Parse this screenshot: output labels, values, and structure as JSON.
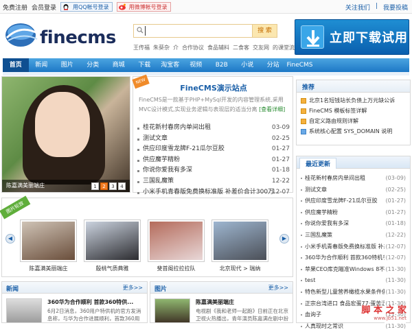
{
  "topbar": {
    "register": "免费注册",
    "login": "会员登录",
    "qq_login": "用QQ帐号登录",
    "weibo_login": "用微博帐号登录",
    "follow": "关注我们",
    "submit": "我要投稿"
  },
  "header": {
    "logo_text": "finecms",
    "search_placeholder": "",
    "search_button": "搜 索",
    "hotwords": [
      "王传福",
      "朱葵杂",
      "介",
      "合作协议",
      "食品辅料",
      "二食客",
      "交友网",
      "的课堂流程"
    ],
    "download_banner": "立即下载试用"
  },
  "nav": {
    "items": [
      "首页",
      "新闻",
      "图片",
      "分类",
      "商城",
      "下载",
      "淘宝客",
      "视频",
      "B2B",
      "小说",
      "分站",
      "FineCMS"
    ],
    "active_index": 0
  },
  "focus": {
    "caption": "陈嘉满美丽端庄",
    "pages": [
      "1",
      "2",
      "3",
      "4"
    ],
    "active_page": 1
  },
  "center": {
    "new_tag": "NEW",
    "title": "FineCMS演示站点",
    "intro": "FineCMS是一款基于PHP+MySql开发的内容管理系统,采用MVC设计模式,实现业务逻辑与表现层的适当分离",
    "intro_more": "[查看详细]",
    "items": [
      {
        "title": "桂花新村春房内单间出租",
        "date": "03-09"
      },
      {
        "title": "测试文章",
        "date": "02-25"
      },
      {
        "title": "供应印度雪龙牌F-21瓜尔豆胶",
        "date": "01-27"
      },
      {
        "title": "供应魔芋精粉",
        "date": "01-27"
      },
      {
        "title": "你说你爱我有多深",
        "date": "01-18"
      },
      {
        "title": "三国乱魔策",
        "date": "12-22"
      },
      {
        "title": "小米手机青春版免费换标准版 补差价合计300万",
        "date": "12-07"
      }
    ]
  },
  "recommend": {
    "title": "推荐",
    "items": [
      "北京1名短钱站长负债上万元缺公诉",
      "FineCMS 模板标签详解",
      "自定义路由规则详解",
      "系统核心配置 SYS_DOMAIN 说明"
    ]
  },
  "latest": {
    "title": "最近更新",
    "items": [
      {
        "title": "桂花新村春房内单间出租",
        "date": "(03-09)"
      },
      {
        "title": "测试文章",
        "date": "(02-25)"
      },
      {
        "title": "供应印度雪龙牌F-21瓜尔豆胶",
        "date": "(01-27)"
      },
      {
        "title": "供应魔芋精粉",
        "date": "(01-27)"
      },
      {
        "title": "你说你爱我有多深",
        "date": "(01-18)"
      },
      {
        "title": "三国乱魔策",
        "date": "(12-22)"
      },
      {
        "title": "小米手机青春版免费换标准版 补差价",
        "date": "(12-07)"
      },
      {
        "title": "360华为合作顺利 首款360特机手机7月",
        "date": "(12-07)"
      },
      {
        "title": "苹果CEO库克瞄准Windows 8不化不",
        "date": "(11-30)"
      },
      {
        "title": "test",
        "date": "(11-30)"
      },
      {
        "title": "特色新型儿童营养橄榄水果条件俱备",
        "date": "(11-30)"
      },
      {
        "title": "正宗台湾进口 食品宏蛋77·蛋苦涩咖",
        "date": "(11-30)"
      },
      {
        "title": "血询子",
        "date": "(11-30)"
      },
      {
        "title": "人真现时之常识",
        "date": "(11-30)"
      }
    ]
  },
  "scroller": {
    "ribbon": "图片轮放",
    "items": [
      {
        "caption": "陈嘉满美丽端庄",
        "color1": "#cfc3b6",
        "color2": "#6a4e3b"
      },
      {
        "caption": "殷桃气质典雅",
        "color1": "#cbd3df",
        "color2": "#2c2c30"
      },
      {
        "caption": "斐首阁拉拉拉队",
        "color1": "#b46b5b",
        "color2": "#e8d7d7"
      },
      {
        "caption": "北京现代 > 瑞纳",
        "color1": "#9eb6d0",
        "color2": "#4b4f57"
      }
    ]
  },
  "news_box": {
    "title": "新闻",
    "more": "更多>>",
    "headline": "360华为合作顺利 首款360特供...",
    "desc": "6月2日消息，360用户特供机的官方发消息称，与华为合作进展顺利，首款360用"
  },
  "pic_box": {
    "title": "图片",
    "more": "更多>>",
    "headline": "陈嘉满美丽端庄",
    "desc": "电视剧《我和老师一起跑》日前正在北京卫视火热播出，青年演员陈嘉满在剧中扮"
  },
  "watermark": {
    "text": "脚 本 之 家",
    "url": "www.jb51.net"
  }
}
